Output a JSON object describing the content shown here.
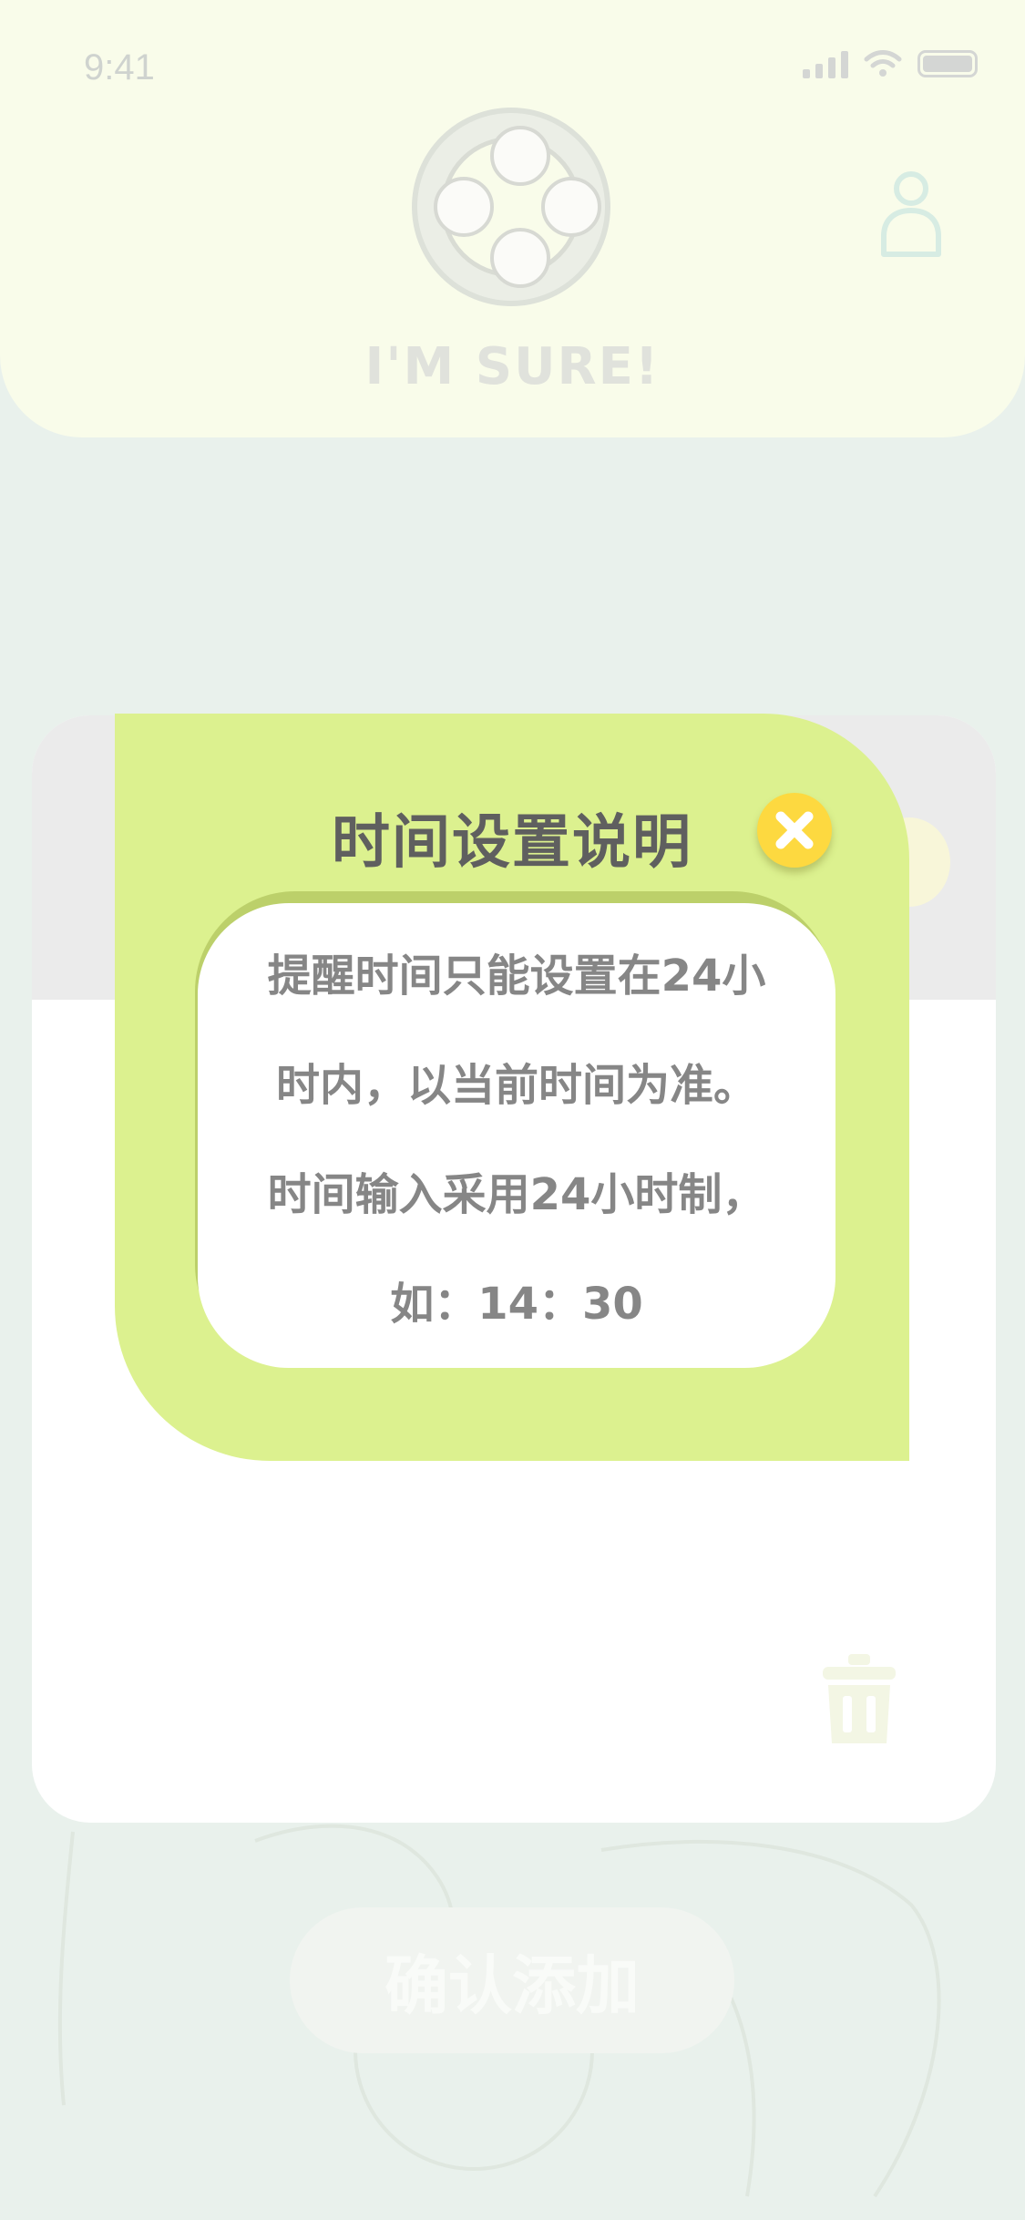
{
  "status_bar": {
    "time": "9:41"
  },
  "header": {
    "app_name": "I'M SURE!",
    "logo_caption": "I'M SURE"
  },
  "modal": {
    "title": "时间设置说明",
    "lines": [
      "提醒时间只能设置在24小",
      "时内，以当前时间为准。",
      "时间输入采用24小时制，",
      "如：14：30"
    ]
  },
  "footer": {
    "confirm_label": "确认添加"
  },
  "colors": {
    "modal_background": "#dcf18f",
    "close_button": "#fdd940",
    "header_background": "#f9fcea",
    "page_background": "#e9f1ec"
  }
}
